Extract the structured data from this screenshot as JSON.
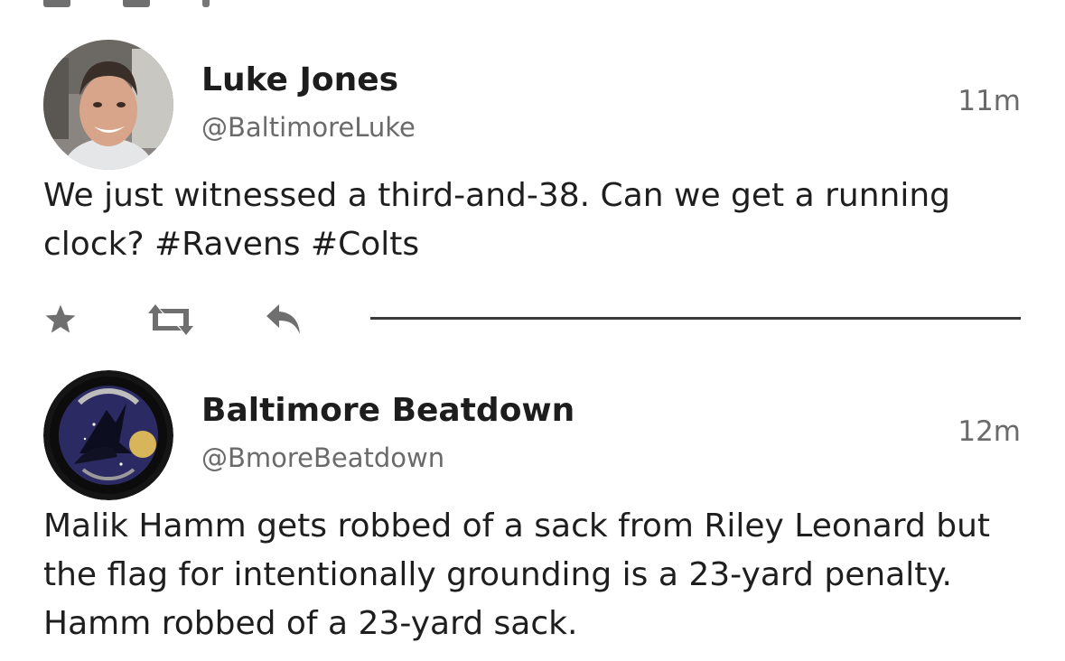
{
  "tweets": [
    {
      "name": "Luke Jones",
      "handle": "@BaltimoreLuke",
      "time": "11m",
      "text": "We just witnessed a third-and-38. Can we get a running clock? #Ravens #Colts"
    },
    {
      "name": "Baltimore Beatdown",
      "handle": "@BmoreBeatdown",
      "time": "12m",
      "text": "Malik Hamm gets robbed of a sack from Riley Leonard but the flag for intentionally grounding is a 23-yard penalty. Hamm robbed of a 23-yard sack."
    }
  ],
  "actions": {
    "icons": [
      "star-icon",
      "retweet-icon",
      "reply-icon"
    ],
    "icon_color": "#6f6f6f"
  },
  "colors": {
    "text": "#1e1e1e",
    "secondary_text": "#6a6a6a",
    "divider": "#3a3a3a"
  }
}
